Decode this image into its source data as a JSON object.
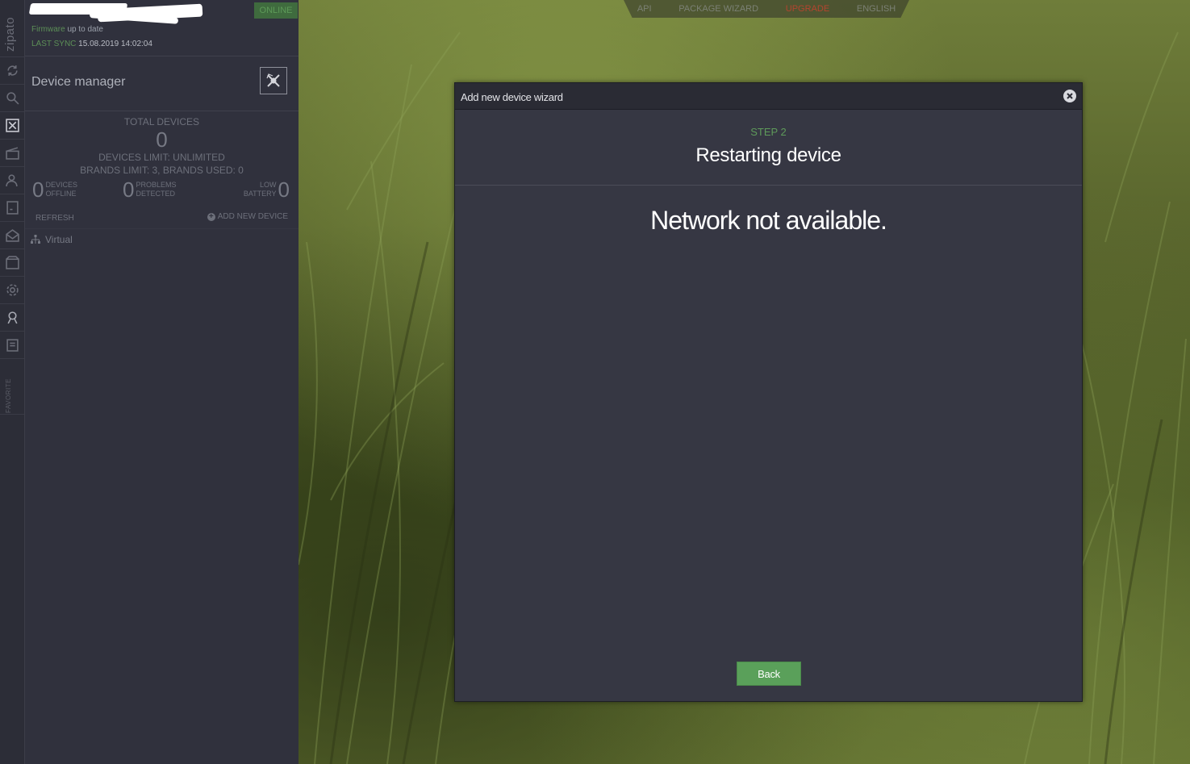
{
  "colors": {
    "accent_green": "#5aa05a",
    "online_green": "#5c8f57",
    "upgrade_red": "#b3452f",
    "panel_bg": "#30313d",
    "modal_bg": "#363743"
  },
  "rail": {
    "logo": "zipato",
    "favorite": "FAVORITE",
    "icons": [
      "sync-icon",
      "search-icon",
      "device-manager-icon",
      "scenes-icon",
      "users-icon",
      "rules-icon",
      "messages-icon",
      "store-icon",
      "settings-icon",
      "support-icon",
      "notes-icon"
    ]
  },
  "box": {
    "status": "ONLINE",
    "firmware_label": "Firmware",
    "firmware_text": "up to date",
    "last_sync_label": "LAST SYNC",
    "last_sync_value": "15.08.2019 14:02:04"
  },
  "device_manager": {
    "title": "Device manager",
    "total_devices_label": "TOTAL DEVICES",
    "total_devices_value": "0",
    "devices_limit": "DEVICES LIMIT: UNLIMITED",
    "brands_limit": "BRANDS LIMIT: 3, BRANDS USED: 0",
    "offline": {
      "value": "0",
      "line1": "DEVICES",
      "line2": "OFFLINE"
    },
    "problems": {
      "value": "0",
      "line1": "PROBLEMS",
      "line2": "DETECTED"
    },
    "battery": {
      "value": "0",
      "line1": "LOW",
      "line2": "BATTERY"
    },
    "refresh_label": "REFRESH",
    "add_new_label": "ADD NEW DEVICE",
    "tree": [
      {
        "label": "Virtual",
        "icon": "network-tree-icon"
      }
    ]
  },
  "topnav": {
    "api": "API",
    "package_wizard": "PACKAGE WIZARD",
    "upgrade": "UPGRADE",
    "language": "ENGLISH"
  },
  "modal": {
    "title": "Add new device wizard",
    "step_label": "STEP 2",
    "step_title": "Restarting device",
    "message": "Network not available.",
    "back_label": "Back"
  }
}
